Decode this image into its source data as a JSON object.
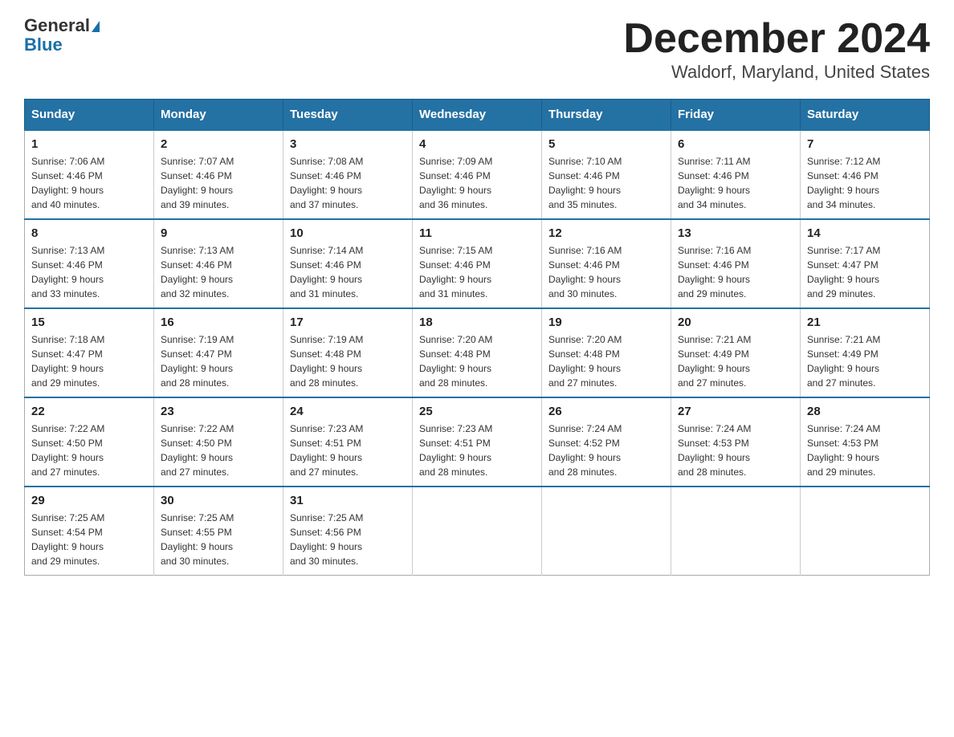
{
  "header": {
    "logo_general": "General",
    "logo_blue": "Blue",
    "title": "December 2024",
    "subtitle": "Waldorf, Maryland, United States"
  },
  "days_of_week": [
    "Sunday",
    "Monday",
    "Tuesday",
    "Wednesday",
    "Thursday",
    "Friday",
    "Saturday"
  ],
  "weeks": [
    [
      {
        "day": "1",
        "sunrise": "7:06 AM",
        "sunset": "4:46 PM",
        "daylight": "9 hours and 40 minutes."
      },
      {
        "day": "2",
        "sunrise": "7:07 AM",
        "sunset": "4:46 PM",
        "daylight": "9 hours and 39 minutes."
      },
      {
        "day": "3",
        "sunrise": "7:08 AM",
        "sunset": "4:46 PM",
        "daylight": "9 hours and 37 minutes."
      },
      {
        "day": "4",
        "sunrise": "7:09 AM",
        "sunset": "4:46 PM",
        "daylight": "9 hours and 36 minutes."
      },
      {
        "day": "5",
        "sunrise": "7:10 AM",
        "sunset": "4:46 PM",
        "daylight": "9 hours and 35 minutes."
      },
      {
        "day": "6",
        "sunrise": "7:11 AM",
        "sunset": "4:46 PM",
        "daylight": "9 hours and 34 minutes."
      },
      {
        "day": "7",
        "sunrise": "7:12 AM",
        "sunset": "4:46 PM",
        "daylight": "9 hours and 34 minutes."
      }
    ],
    [
      {
        "day": "8",
        "sunrise": "7:13 AM",
        "sunset": "4:46 PM",
        "daylight": "9 hours and 33 minutes."
      },
      {
        "day": "9",
        "sunrise": "7:13 AM",
        "sunset": "4:46 PM",
        "daylight": "9 hours and 32 minutes."
      },
      {
        "day": "10",
        "sunrise": "7:14 AM",
        "sunset": "4:46 PM",
        "daylight": "9 hours and 31 minutes."
      },
      {
        "day": "11",
        "sunrise": "7:15 AM",
        "sunset": "4:46 PM",
        "daylight": "9 hours and 31 minutes."
      },
      {
        "day": "12",
        "sunrise": "7:16 AM",
        "sunset": "4:46 PM",
        "daylight": "9 hours and 30 minutes."
      },
      {
        "day": "13",
        "sunrise": "7:16 AM",
        "sunset": "4:46 PM",
        "daylight": "9 hours and 29 minutes."
      },
      {
        "day": "14",
        "sunrise": "7:17 AM",
        "sunset": "4:47 PM",
        "daylight": "9 hours and 29 minutes."
      }
    ],
    [
      {
        "day": "15",
        "sunrise": "7:18 AM",
        "sunset": "4:47 PM",
        "daylight": "9 hours and 29 minutes."
      },
      {
        "day": "16",
        "sunrise": "7:19 AM",
        "sunset": "4:47 PM",
        "daylight": "9 hours and 28 minutes."
      },
      {
        "day": "17",
        "sunrise": "7:19 AM",
        "sunset": "4:48 PM",
        "daylight": "9 hours and 28 minutes."
      },
      {
        "day": "18",
        "sunrise": "7:20 AM",
        "sunset": "4:48 PM",
        "daylight": "9 hours and 28 minutes."
      },
      {
        "day": "19",
        "sunrise": "7:20 AM",
        "sunset": "4:48 PM",
        "daylight": "9 hours and 27 minutes."
      },
      {
        "day": "20",
        "sunrise": "7:21 AM",
        "sunset": "4:49 PM",
        "daylight": "9 hours and 27 minutes."
      },
      {
        "day": "21",
        "sunrise": "7:21 AM",
        "sunset": "4:49 PM",
        "daylight": "9 hours and 27 minutes."
      }
    ],
    [
      {
        "day": "22",
        "sunrise": "7:22 AM",
        "sunset": "4:50 PM",
        "daylight": "9 hours and 27 minutes."
      },
      {
        "day": "23",
        "sunrise": "7:22 AM",
        "sunset": "4:50 PM",
        "daylight": "9 hours and 27 minutes."
      },
      {
        "day": "24",
        "sunrise": "7:23 AM",
        "sunset": "4:51 PM",
        "daylight": "9 hours and 27 minutes."
      },
      {
        "day": "25",
        "sunrise": "7:23 AM",
        "sunset": "4:51 PM",
        "daylight": "9 hours and 28 minutes."
      },
      {
        "day": "26",
        "sunrise": "7:24 AM",
        "sunset": "4:52 PM",
        "daylight": "9 hours and 28 minutes."
      },
      {
        "day": "27",
        "sunrise": "7:24 AM",
        "sunset": "4:53 PM",
        "daylight": "9 hours and 28 minutes."
      },
      {
        "day": "28",
        "sunrise": "7:24 AM",
        "sunset": "4:53 PM",
        "daylight": "9 hours and 29 minutes."
      }
    ],
    [
      {
        "day": "29",
        "sunrise": "7:25 AM",
        "sunset": "4:54 PM",
        "daylight": "9 hours and 29 minutes."
      },
      {
        "day": "30",
        "sunrise": "7:25 AM",
        "sunset": "4:55 PM",
        "daylight": "9 hours and 30 minutes."
      },
      {
        "day": "31",
        "sunrise": "7:25 AM",
        "sunset": "4:56 PM",
        "daylight": "9 hours and 30 minutes."
      },
      null,
      null,
      null,
      null
    ]
  ],
  "labels": {
    "sunrise": "Sunrise:",
    "sunset": "Sunset:",
    "daylight": "Daylight:"
  }
}
